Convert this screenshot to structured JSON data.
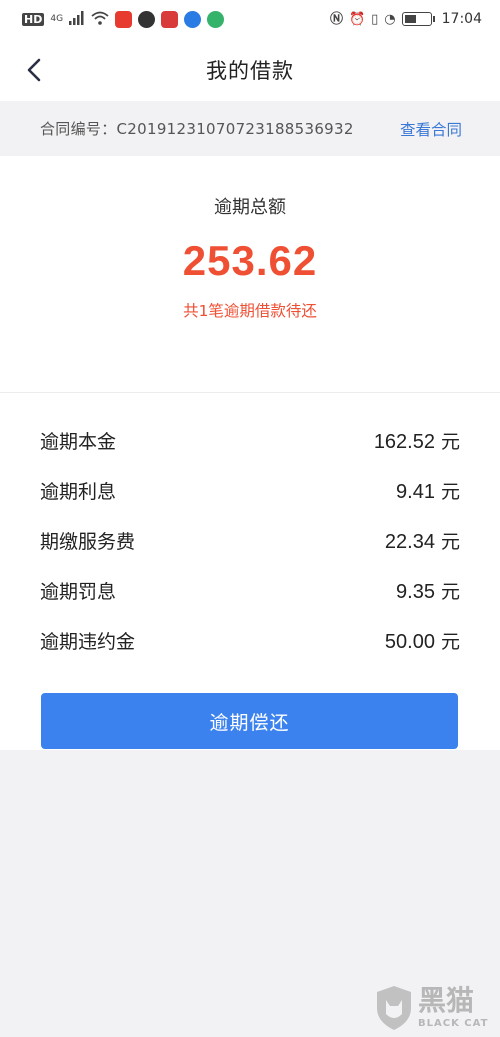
{
  "status_bar": {
    "left_badges": [
      "HD",
      "4G"
    ],
    "time": "17:04",
    "app_icon_colors": [
      "#e63b2e",
      "#333333",
      "#d93a3a",
      "#2a7be3",
      "#35b36b"
    ]
  },
  "nav": {
    "back_icon": "chevron-left-icon",
    "title": "我的借款"
  },
  "contract": {
    "label": "合同编号：",
    "number": "C2019123107072318853693​2",
    "link": "查看合同"
  },
  "summary": {
    "label": "逾期总额",
    "amount": "253.62",
    "note": "共1笔逾期借款待还"
  },
  "details": [
    {
      "label": "逾期本金",
      "value": "162.52",
      "unit": "元"
    },
    {
      "label": "逾期利息",
      "value": "9.41",
      "unit": "元"
    },
    {
      "label": "期缴服务费",
      "value": "22.34",
      "unit": "元"
    },
    {
      "label": "逾期罚息",
      "value": "9.35",
      "unit": "元"
    },
    {
      "label": "逾期违约金",
      "value": "50.00",
      "unit": "元"
    }
  ],
  "pay_button": "逾期偿还",
  "colors": {
    "accent_red": "#ef4f33",
    "button_blue": "#3b82ef",
    "link_blue": "#3a78d6"
  },
  "watermark": {
    "cn": "黑猫",
    "en": "BLACK CAT"
  }
}
